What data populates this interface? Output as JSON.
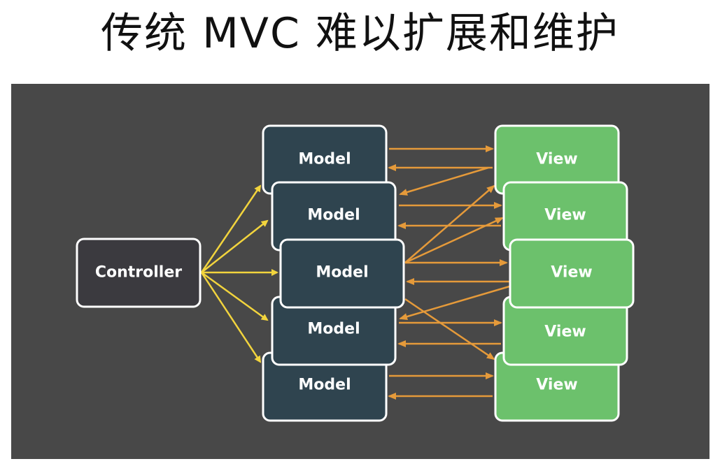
{
  "title": "传统 MVC 难以扩展和维护",
  "controller": {
    "label": "Controller"
  },
  "models": [
    {
      "label": "Model"
    },
    {
      "label": "Model"
    },
    {
      "label": "Model"
    },
    {
      "label": "Model"
    },
    {
      "label": "Model"
    }
  ],
  "views": [
    {
      "label": "View"
    },
    {
      "label": "View"
    },
    {
      "label": "View"
    },
    {
      "label": "View"
    },
    {
      "label": "View"
    }
  ],
  "colors": {
    "stage_bg": "#484848",
    "controller_fill": "#3b3a3f",
    "model_fill": "#2f444f",
    "view_fill": "#6cc16c",
    "node_border": "#ffffff",
    "controller_arrow": "#f2d43d",
    "link_arrow": "#e59a3a"
  }
}
